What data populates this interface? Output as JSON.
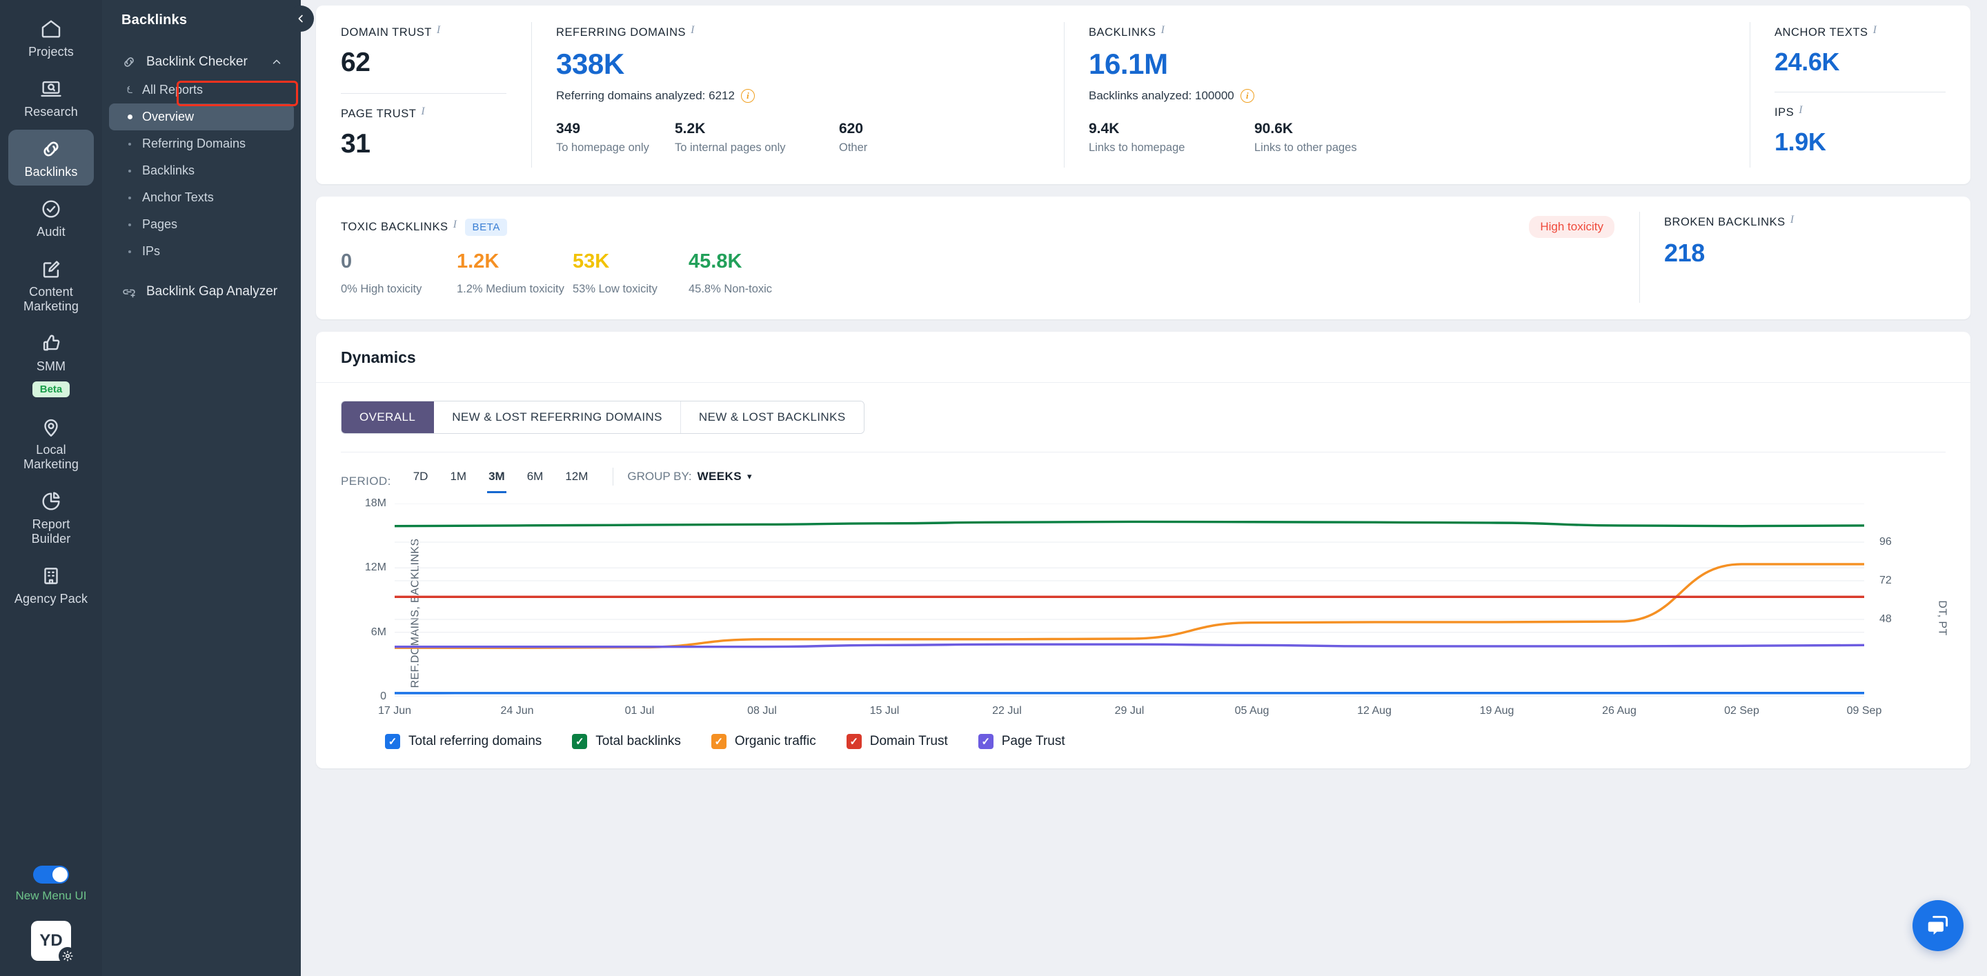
{
  "rail": {
    "items": [
      {
        "label": "Projects",
        "icon": "home-icon",
        "active": false
      },
      {
        "label": "Research",
        "icon": "laptop-search-icon",
        "active": false
      },
      {
        "label": "Backlinks",
        "icon": "link-icon",
        "active": true
      },
      {
        "label": "Audit",
        "icon": "check-circle-icon",
        "active": false
      },
      {
        "label": "Content Marketing",
        "icon": "pencil-square-icon",
        "active": false
      },
      {
        "label": "SMM",
        "icon": "thumbs-up-icon",
        "active": false,
        "badge": "Beta"
      },
      {
        "label": "Local Marketing",
        "icon": "map-pin-icon",
        "active": false
      },
      {
        "label": "Report Builder",
        "icon": "pie-chart-icon",
        "active": false
      },
      {
        "label": "Agency Pack",
        "icon": "building-icon",
        "active": false
      }
    ],
    "toggle_label": "New Menu UI",
    "toggle_on": true,
    "avatar_initials": "YD"
  },
  "subnav": {
    "title": "Backlinks",
    "group": {
      "label": "Backlink Checker",
      "expanded": true
    },
    "items": [
      {
        "label": "All Reports",
        "marker": "back-arrow-icon",
        "selected": false
      },
      {
        "label": "Overview",
        "marker": "dot",
        "selected": true
      },
      {
        "label": "Referring Domains",
        "marker": "dot-small",
        "selected": false
      },
      {
        "label": "Backlinks",
        "marker": "dot-small",
        "selected": false
      },
      {
        "label": "Anchor Texts",
        "marker": "dot-small",
        "selected": false
      },
      {
        "label": "Pages",
        "marker": "dot-small",
        "selected": false
      },
      {
        "label": "IPs",
        "marker": "dot-small",
        "selected": false
      }
    ],
    "gap_analyzer": "Backlink Gap Analyzer"
  },
  "metrics": {
    "domain_trust": {
      "title": "DOMAIN TRUST",
      "value": "62"
    },
    "page_trust": {
      "title": "PAGE TRUST",
      "value": "31"
    },
    "referring_domains": {
      "title": "REFERRING DOMAINS",
      "value": "338K",
      "analyzed": "Referring domains analyzed: 6212",
      "splits": [
        {
          "value": "349",
          "caption": "To homepage only"
        },
        {
          "value": "5.2K",
          "caption": "To internal pages only"
        },
        {
          "value": "620",
          "caption": "Other"
        }
      ]
    },
    "backlinks": {
      "title": "BACKLINKS",
      "value": "16.1M",
      "analyzed": "Backlinks analyzed: 100000",
      "splits": [
        {
          "value": "9.4K",
          "caption": "Links to homepage"
        },
        {
          "value": "90.6K",
          "caption": "Links to other pages"
        }
      ]
    },
    "anchor_texts": {
      "title": "ANCHOR TEXTS",
      "value": "24.6K"
    },
    "ips": {
      "title": "IPS",
      "value": "1.9K"
    }
  },
  "toxic": {
    "title": "TOXIC BACKLINKS",
    "beta_tag": "BETA",
    "flag": "High toxicity",
    "flag_color": "#ef4a3b",
    "values": [
      {
        "value": "0",
        "caption": "0% High toxicity",
        "color": "#6b7a89"
      },
      {
        "value": "1.2K",
        "caption": "1.2% Medium toxicity",
        "color": "#f59023"
      },
      {
        "value": "53K",
        "caption": "53% Low toxicity",
        "color": "#f2c200"
      },
      {
        "value": "45.8K",
        "caption": "45.8% Non-toxic",
        "color": "#22a05a"
      }
    ],
    "broken": {
      "title": "BROKEN BACKLINKS",
      "value": "218"
    }
  },
  "dynamics": {
    "title": "Dynamics",
    "tabs": [
      {
        "label": "OVERALL",
        "active": true
      },
      {
        "label": "NEW & LOST REFERRING DOMAINS",
        "active": false
      },
      {
        "label": "NEW & LOST BACKLINKS",
        "active": false
      }
    ],
    "period_label": "PERIOD:",
    "periods": [
      {
        "label": "7D",
        "active": false
      },
      {
        "label": "1M",
        "active": false
      },
      {
        "label": "3M",
        "active": true
      },
      {
        "label": "6M",
        "active": false
      },
      {
        "label": "12M",
        "active": false
      }
    ],
    "groupby_label": "GROUP BY:",
    "groupby_value": "WEEKS"
  },
  "chart_data": {
    "type": "line",
    "title": "Dynamics",
    "xlabel": "",
    "ylabel": "REF.DOMAINS, BACKLINKS",
    "y2label": "DT, PT",
    "ylim": [
      0,
      18000000
    ],
    "yticks": [
      0,
      6000000,
      12000000,
      18000000
    ],
    "ytick_labels": [
      "0",
      "6M",
      "12M",
      "18M"
    ],
    "y2lim": [
      0,
      120
    ],
    "y2ticks": [
      48,
      72,
      96
    ],
    "y2tick_labels": [
      "48",
      "72",
      "96"
    ],
    "grid": true,
    "legend_position": "bottom",
    "x": [
      "17 Jun",
      "24 Jun",
      "01 Jul",
      "08 Jul",
      "15 Jul",
      "22 Jul",
      "29 Jul",
      "05 Aug",
      "12 Aug",
      "19 Aug",
      "26 Aug",
      "02 Sep",
      "09 Sep"
    ],
    "series": [
      {
        "name": "Total referring domains",
        "color": "#1a73e8",
        "axis": "left",
        "checked": true,
        "values": [
          330000,
          331000,
          332000,
          333000,
          334000,
          335000,
          336000,
          336500,
          337000,
          337500,
          338000,
          338000,
          338000
        ]
      },
      {
        "name": "Total backlinks",
        "color": "#0a8043",
        "axis": "left",
        "checked": true,
        "values": [
          15900000,
          15950000,
          16000000,
          16050000,
          16150000,
          16250000,
          16300000,
          16280000,
          16250000,
          16200000,
          15950000,
          15900000,
          15950000
        ]
      },
      {
        "name": "Organic traffic",
        "color": "#f59023",
        "axis": "left",
        "checked": true,
        "values": [
          4550000,
          4550000,
          4600000,
          5350000,
          5350000,
          5350000,
          5400000,
          6900000,
          6950000,
          6950000,
          7000000,
          12350000,
          12350000
        ]
      },
      {
        "name": "Domain Trust",
        "color": "#d93a2b",
        "axis": "right",
        "checked": true,
        "values": [
          62,
          62,
          62,
          62,
          62,
          62,
          62,
          62,
          62,
          62,
          62,
          62,
          62
        ]
      },
      {
        "name": "Page Trust",
        "color": "#6c5ce0",
        "axis": "right",
        "checked": true,
        "values": [
          31,
          31,
          31,
          31,
          32,
          32.5,
          32.5,
          32,
          31.3,
          31.3,
          31.3,
          31.6,
          32
        ]
      }
    ]
  }
}
